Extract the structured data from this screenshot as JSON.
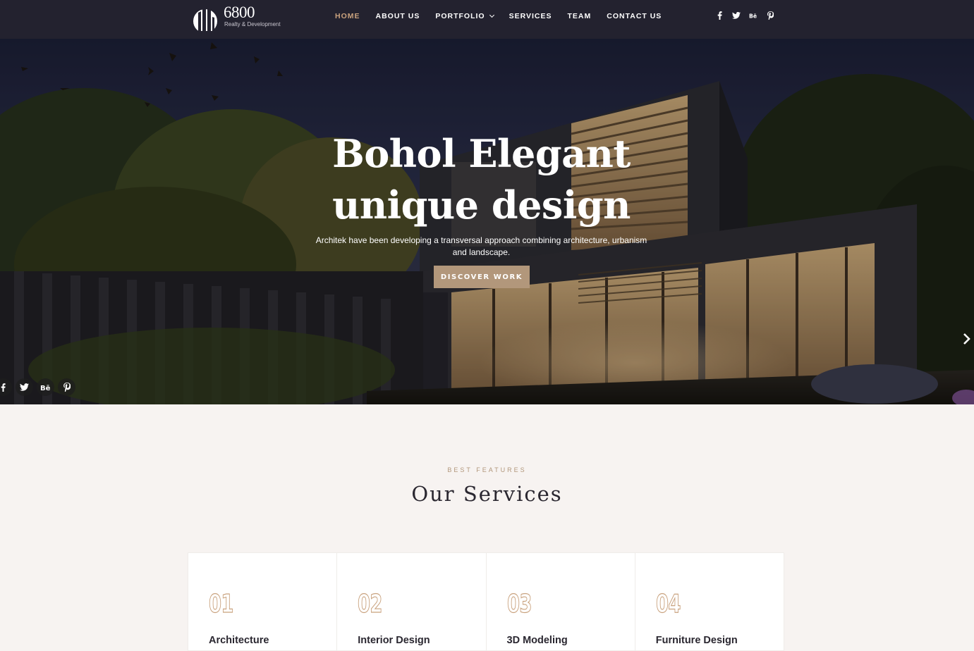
{
  "brand": {
    "name": "6800",
    "tagline": "Realty & Development"
  },
  "nav": {
    "items": [
      {
        "label": "HOME",
        "active": true
      },
      {
        "label": "ABOUT US",
        "active": false
      },
      {
        "label": "PORTFOLIO",
        "active": false,
        "has_dropdown": true
      },
      {
        "label": "SERVICES",
        "active": false
      },
      {
        "label": "TEAM",
        "active": false
      },
      {
        "label": "CONTACT US",
        "active": false
      }
    ]
  },
  "header_social": [
    "facebook-icon",
    "twitter-icon",
    "behance-icon",
    "pinterest-icon"
  ],
  "hero": {
    "title_line1": "Bohol Elegant",
    "title_line2": "unique design",
    "description": "Architek have been developing a transversal approach combining architecture, urbanism and landscape.",
    "button_label": "DISCOVER WORK",
    "next_icon": "chevron-right-icon",
    "social": [
      "facebook-icon",
      "twitter-icon",
      "behance-icon",
      "pinterest-icon"
    ]
  },
  "services": {
    "kicker": "BEST FEATURES",
    "title": "Our Services",
    "items": [
      {
        "number": "01",
        "name": "Architecture"
      },
      {
        "number": "02",
        "name": "Interior Design"
      },
      {
        "number": "03",
        "name": "3D Modeling"
      },
      {
        "number": "04",
        "name": "Furniture Design"
      }
    ]
  },
  "colors": {
    "header_bg": "#23222f",
    "accent": "#c9a27e",
    "button": "#b2977b",
    "page_bg": "#f7f3f1",
    "heading": "#2a2730"
  }
}
